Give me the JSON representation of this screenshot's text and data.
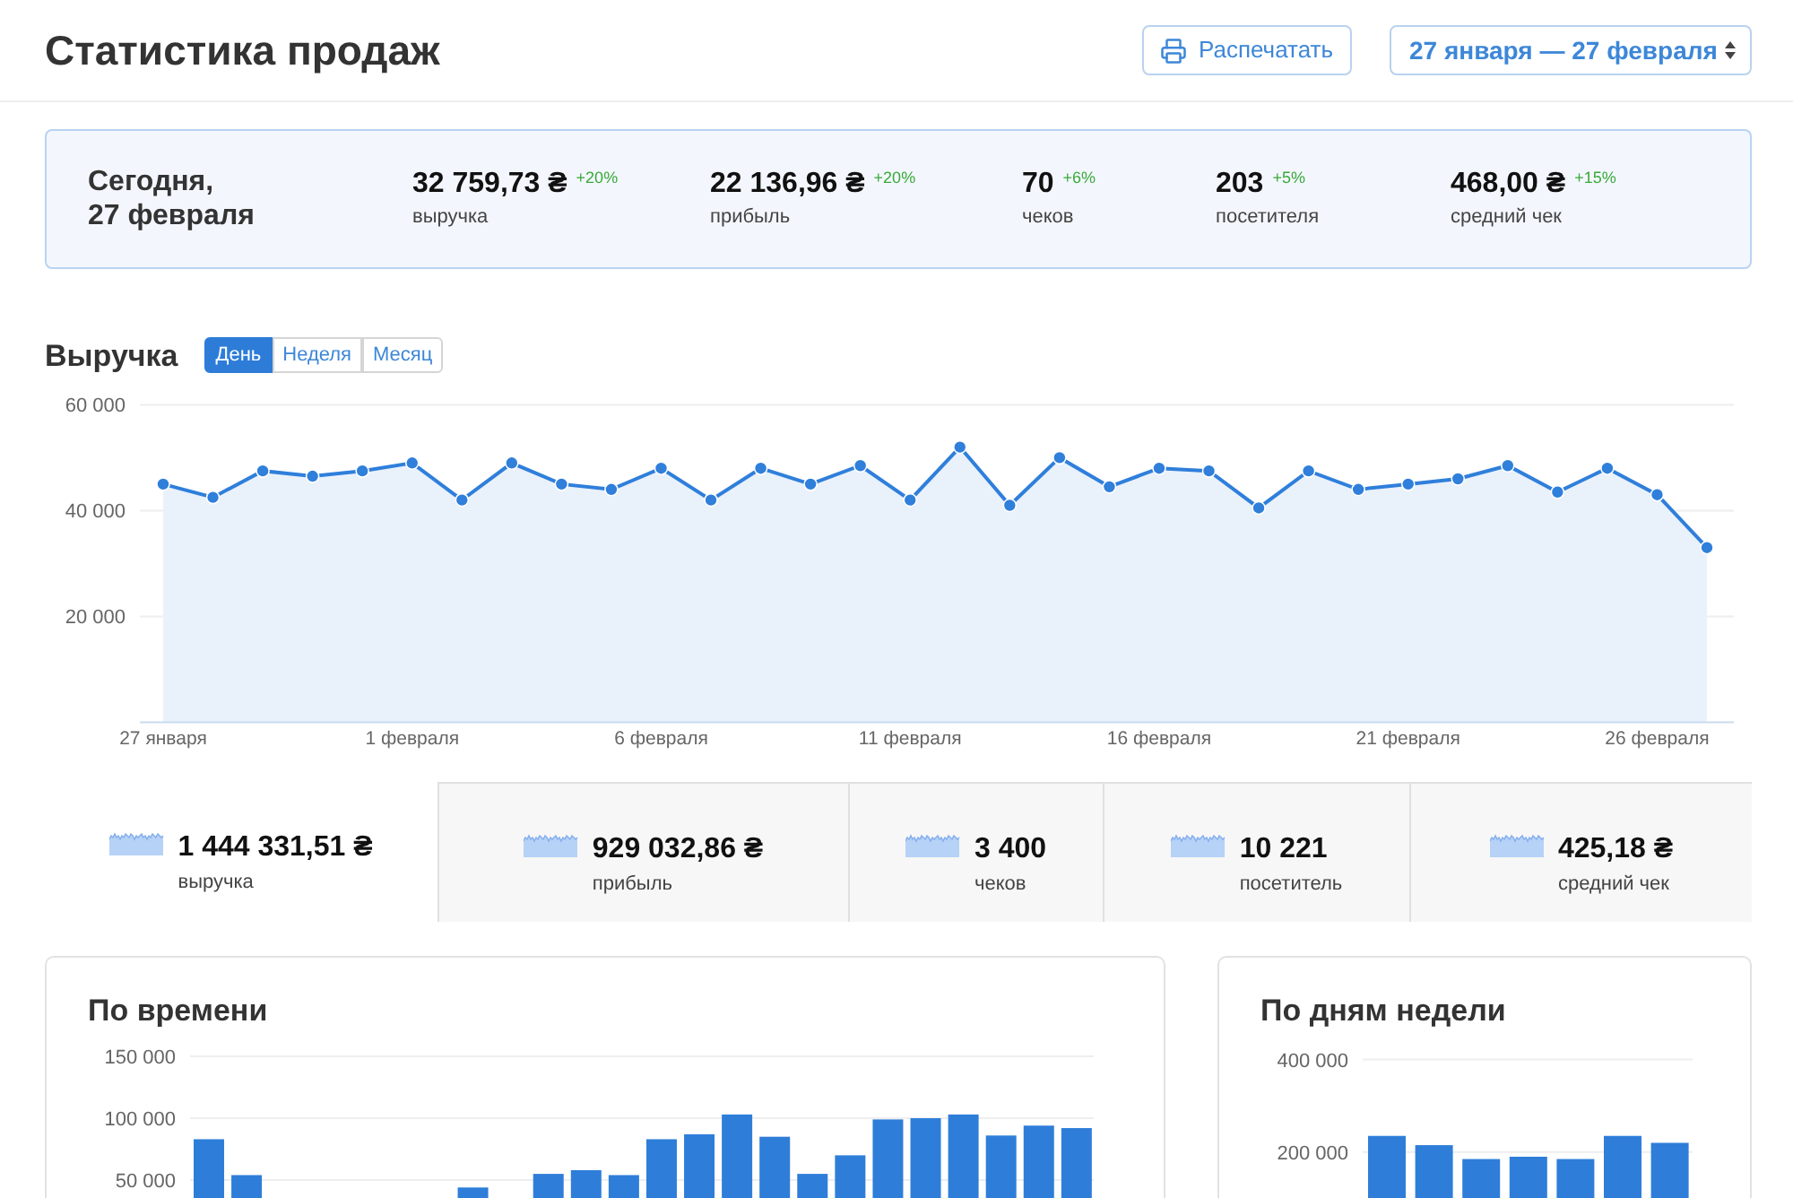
{
  "header": {
    "title": "Статистика продаж",
    "print_button": {
      "label": "Распечатать"
    },
    "date_range": {
      "value": "27 января — 27 февраля"
    }
  },
  "today": {
    "title": "Сегодня,\n27 февраля",
    "metrics": [
      {
        "value": "32 759,73 ₴",
        "change": "+20%",
        "label": "выручка"
      },
      {
        "value": "22 136,96 ₴",
        "change": "+20%",
        "label": "прибыль"
      },
      {
        "value": "70",
        "change": "+6%",
        "label": "чеков"
      },
      {
        "value": "203",
        "change": "+5%",
        "label": "посетителя"
      },
      {
        "value": "468,00 ₴",
        "change": "+15%",
        "label": "средний чек"
      }
    ]
  },
  "revenue": {
    "title": "Выручка",
    "tabs": [
      {
        "label": "День",
        "selected": true
      },
      {
        "label": "Неделя",
        "selected": false
      },
      {
        "label": "Месяц",
        "selected": false
      }
    ],
    "chart_data": {
      "type": "area",
      "categories": [
        "27 января",
        null,
        null,
        null,
        null,
        "1 февраля",
        null,
        null,
        null,
        null,
        "6 февраля",
        null,
        null,
        null,
        null,
        "11 февраля",
        null,
        null,
        null,
        null,
        "16 февраля",
        null,
        null,
        null,
        null,
        "21 февраля",
        null,
        null,
        null,
        null,
        "26 февраля",
        null
      ],
      "series": [
        {
          "color": "#2f7fdb",
          "values": [
            45000,
            42500,
            47500,
            46500,
            47500,
            49000,
            42000,
            49000,
            45000,
            44000,
            48000,
            42000,
            48000,
            45000,
            48500,
            42000,
            52000,
            41000,
            50000,
            44500,
            48000,
            47500,
            40500,
            47500,
            44000,
            45000,
            46000,
            48500,
            43500,
            48000,
            43000,
            33000
          ]
        }
      ],
      "ylim": [
        0,
        60000
      ],
      "yticks": [
        {
          "value": 20000,
          "label": "20 000"
        },
        {
          "value": 40000,
          "label": "40 000"
        },
        {
          "value": 60000,
          "label": "60 000"
        }
      ]
    }
  },
  "totals": [
    {
      "value": "1 444 331,51 ₴",
      "label": "выручка",
      "selected": true
    },
    {
      "value": "929 032,86 ₴",
      "label": "прибыль",
      "selected": false
    },
    {
      "value": "3 400",
      "label": "чеков",
      "selected": false
    },
    {
      "value": "10 221",
      "label": "посетитель",
      "selected": false
    },
    {
      "value": "425,18 ₴",
      "label": "средний чек",
      "selected": false
    }
  ],
  "by_time": {
    "title": "По времени",
    "chart_data": {
      "type": "bar",
      "values": [
        83000,
        54000,
        null,
        null,
        null,
        null,
        null,
        44000,
        null,
        55000,
        58000,
        54000,
        83000,
        87000,
        103000,
        85000,
        55000,
        70000,
        99000,
        100000,
        103000,
        86000,
        94000,
        92000
      ],
      "ylim": [
        35500,
        150000
      ],
      "yticks": [
        {
          "value": 50000,
          "label": "50 000"
        },
        {
          "value": 100000,
          "label": "100 000"
        },
        {
          "value": 150000,
          "label": "150 000"
        }
      ]
    }
  },
  "by_weekday": {
    "title": "По дням недели",
    "chart_data": {
      "type": "bar",
      "values": [
        235000,
        215000,
        185000,
        190000,
        185000,
        235000,
        220000
      ],
      "ylim": [
        100800,
        400000
      ],
      "yticks": [
        {
          "value": 200000,
          "label": "200 000"
        },
        {
          "value": 400000,
          "label": "400 000"
        }
      ]
    }
  }
}
